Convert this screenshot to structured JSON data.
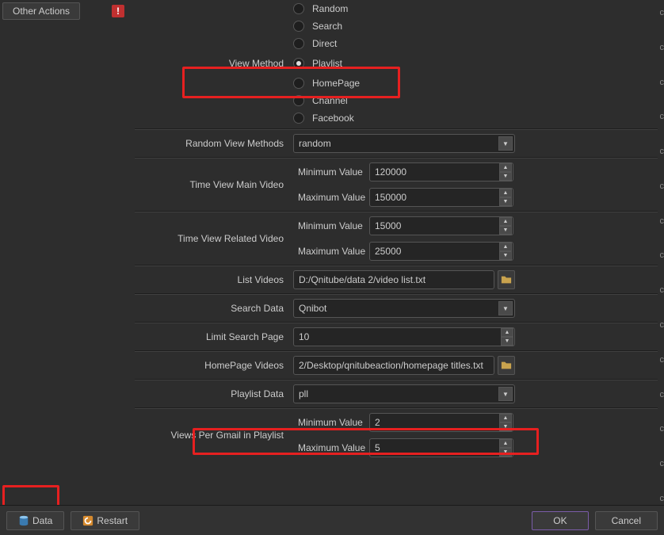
{
  "menu": {
    "otherActions": "Other Actions",
    "notif": "!"
  },
  "viewMethod": {
    "label": "View Method",
    "options": [
      "Random",
      "Search",
      "Direct",
      "Playlist",
      "HomePage",
      "Channel",
      "Facebook"
    ],
    "selected": "Playlist"
  },
  "randomViewMethods": {
    "label": "Random View Methods",
    "value": "random"
  },
  "timeMain": {
    "label": "Time View Main Video",
    "minLabel": "Minimum Value",
    "maxLabel": "Maximum Value",
    "min": "120000",
    "max": "150000"
  },
  "timeRelated": {
    "label": "Time View Related Video",
    "minLabel": "Minimum Value",
    "maxLabel": "Maximum Value",
    "min": "15000",
    "max": "25000"
  },
  "listVideos": {
    "label": "List Videos",
    "value": "D:/Qnitube/data 2/video list.txt"
  },
  "searchData": {
    "label": "Search Data",
    "value": "Qnibot"
  },
  "limitSearch": {
    "label": "Limit Search Page",
    "value": "10"
  },
  "homepageVideos": {
    "label": "HomePage Videos",
    "value": "2/Desktop/qnitubeaction/homepage titles.txt"
  },
  "playlistData": {
    "label": "Playlist Data",
    "value": "pll"
  },
  "viewsPerGmail": {
    "label": "Views Per Gmail in Playlist",
    "minLabel": "Minimum Value",
    "maxLabel": "Maximum Value",
    "min": "2",
    "max": "5"
  },
  "footer": {
    "data": "Data",
    "restart": "Restart",
    "ok": "OK",
    "cancel": "Cancel"
  },
  "rightMark": "c"
}
